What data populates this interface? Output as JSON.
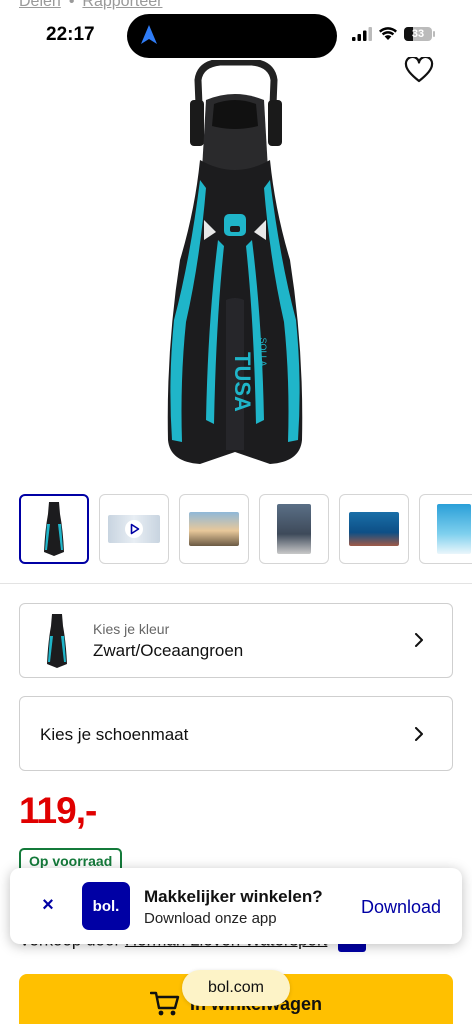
{
  "top_links": {
    "share": "Delen",
    "separator": "•",
    "report": "Rapporteer"
  },
  "status_bar": {
    "time": "22:17",
    "battery": "33"
  },
  "product": {
    "brand_mark": "TUSA",
    "model_mark": "SOLLA",
    "colors": {
      "body": "#1c1c1e",
      "accent": "#1fb5c9",
      "brand_blue": "#0000a4",
      "price_red": "#e00000",
      "stock_green": "#147a3a",
      "cart_yellow": "#ffc000"
    }
  },
  "gallery": {
    "thumbnails": [
      {
        "name": "fin-front",
        "active": true
      },
      {
        "name": "video",
        "active": false
      },
      {
        "name": "pier-photo",
        "active": false
      },
      {
        "name": "divers-photo",
        "active": false
      },
      {
        "name": "reef-photo",
        "active": false
      },
      {
        "name": "underwater-photo",
        "active": false
      }
    ]
  },
  "color_selector": {
    "label": "Kies je kleur",
    "value": "Zwart/Oceaangroen"
  },
  "size_selector": {
    "label": "Kies je schoenmaat"
  },
  "price": "119,-",
  "stock": "Op voorraad",
  "seller": {
    "prefix": "Verkoop door",
    "name": "Herman Lieven Watersport"
  },
  "cart_button": {
    "label": "In winkelwagen"
  },
  "app_banner": {
    "close": "×",
    "logo": "bol.",
    "title": "Makkelijker winkelen?",
    "subtitle": "Download onze app",
    "action": "Download"
  },
  "url_pill": "bol.com"
}
